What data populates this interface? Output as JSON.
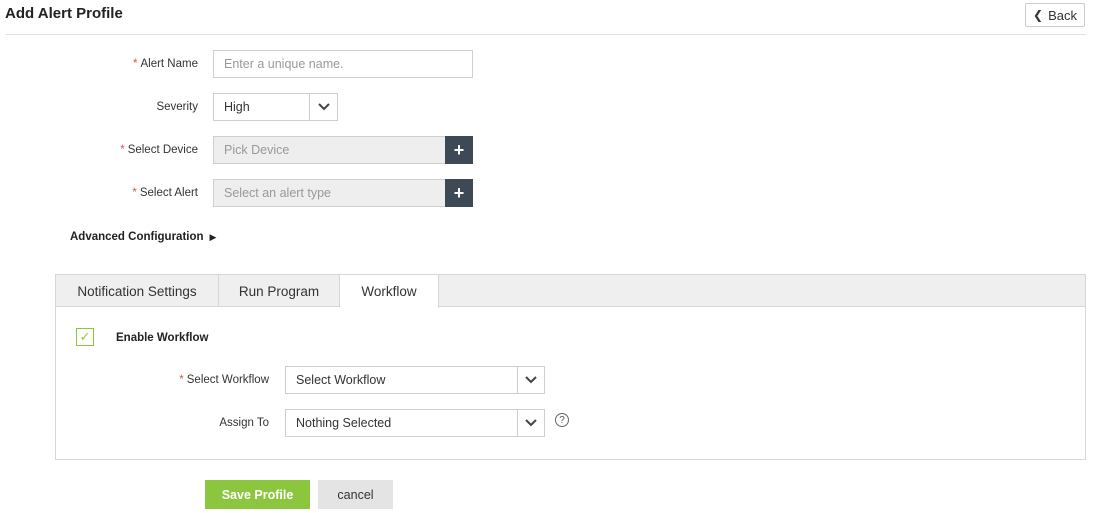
{
  "header": {
    "title": "Add Alert Profile",
    "back_label": "Back"
  },
  "form": {
    "alert_name": {
      "label": "Alert Name",
      "required": "*",
      "placeholder": "Enter a unique name."
    },
    "severity": {
      "label": "Severity",
      "value": "High"
    },
    "select_device": {
      "label": "Select Device",
      "required": "*",
      "placeholder": "Pick Device",
      "button": "+"
    },
    "select_alert": {
      "label": "Select Alert",
      "required": "*",
      "placeholder": "Select an alert type",
      "button": "+"
    },
    "advanced_configuration": "Advanced Configuration"
  },
  "tabs": [
    {
      "label": "Notification Settings",
      "active": false
    },
    {
      "label": "Run Program",
      "active": false
    },
    {
      "label": "Workflow",
      "active": true
    }
  ],
  "workflow": {
    "enable_label": "Enable Workflow",
    "enabled": true,
    "select_workflow": {
      "label": "Select Workflow",
      "required": "*",
      "value": "Select Workflow"
    },
    "assign_to": {
      "label": "Assign To",
      "value": "Nothing Selected"
    },
    "help": "?"
  },
  "actions": {
    "save_label": "Save Profile",
    "cancel_label": "cancel"
  },
  "colors": {
    "accent": "#8cc63f",
    "required": "#d9534f",
    "dark_button": "#3d4a55"
  },
  "icons": {
    "back": "chevron-left-icon",
    "dropdown": "chevron-down-icon",
    "add": "plus-icon",
    "advanced_toggle": "caret-right-icon",
    "checkbox": "check-icon",
    "help": "question-circle-icon"
  }
}
